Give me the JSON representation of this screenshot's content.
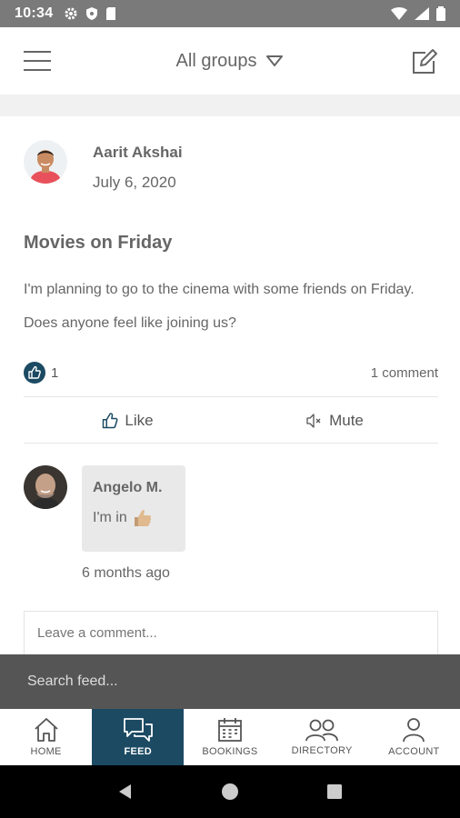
{
  "status_bar": {
    "time": "10:34"
  },
  "header": {
    "group_selector": "All groups"
  },
  "post": {
    "author": "Aarit Akshai",
    "date": "July 6, 2020",
    "title": "Movies on Friday",
    "body": "I'm planning to go to the cinema with some friends on Friday. Does anyone feel like joining us?",
    "like_count": "1",
    "comment_count": "1 comment",
    "like_label": "Like",
    "mute_label": "Mute"
  },
  "comment": {
    "author": "Angelo M.",
    "text": "I'm in",
    "time": "6 months ago"
  },
  "comment_input": {
    "placeholder": "Leave a comment..."
  },
  "search": {
    "placeholder": "Search feed..."
  },
  "nav": {
    "items": [
      {
        "label": "HOME",
        "icon": "home-icon",
        "active": false
      },
      {
        "label": "FEED",
        "icon": "chat-bubbles-icon",
        "active": true
      },
      {
        "label": "BOOKINGS",
        "icon": "calendar-icon",
        "active": false
      },
      {
        "label": "DIRECTORY",
        "icon": "people-icon",
        "active": false
      },
      {
        "label": "ACCOUNT",
        "icon": "person-icon",
        "active": false
      }
    ]
  },
  "colors": {
    "accent": "#1c4a63",
    "status_bar": "#7a7a7a",
    "search_bar": "#555555"
  }
}
